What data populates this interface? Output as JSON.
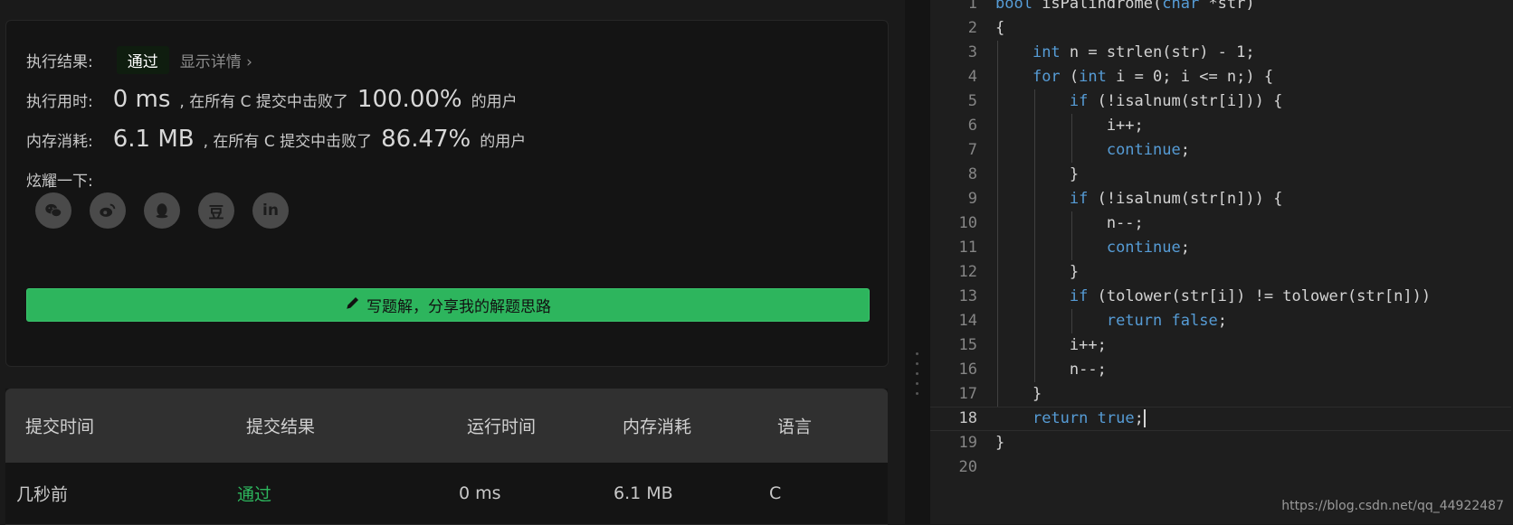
{
  "result": {
    "status_label": "执行结果:",
    "status_value": "通过",
    "show_details": "显示详情",
    "runtime_label": "执行用时:",
    "runtime_value": "0 ms",
    "runtime_mid": ", 在所有 C 提交中击败了",
    "runtime_percent": "100.00%",
    "runtime_suffix": "的用户",
    "memory_label": "内存消耗:",
    "memory_value": "6.1 MB",
    "memory_mid": ", 在所有 C 提交中击败了",
    "memory_percent": "86.47%",
    "memory_suffix": "的用户",
    "share_label": "炫耀一下:",
    "share_icons": [
      "wechat-icon",
      "weibo-icon",
      "qq-icon",
      "douban-icon",
      "linkedin-icon"
    ],
    "douban_glyph": "豆",
    "linkedin_glyph": "in",
    "write_solution": "写题解，分享我的解题思路"
  },
  "submissions": {
    "columns": [
      "提交时间",
      "提交结果",
      "运行时间",
      "内存消耗",
      "语言"
    ],
    "rows": [
      {
        "time": "几秒前",
        "result": "通过",
        "runtime": "0 ms",
        "memory": "6.1 MB",
        "language": "C"
      }
    ]
  },
  "editor": {
    "active_line": 18,
    "lines": [
      [
        [
          "kw",
          "bool"
        ],
        [
          "t",
          " isPalindrome("
        ],
        [
          "kw",
          "char"
        ],
        [
          "t",
          " *str)"
        ]
      ],
      [
        [
          "t",
          "{"
        ]
      ],
      [
        [
          "t",
          "    "
        ],
        [
          "kw",
          "int"
        ],
        [
          "t",
          " n = strlen(str) - 1;"
        ]
      ],
      [
        [
          "t",
          "    "
        ],
        [
          "kw",
          "for"
        ],
        [
          "t",
          " ("
        ],
        [
          "kw",
          "int"
        ],
        [
          "t",
          " i = 0; i <= n;) {"
        ]
      ],
      [
        [
          "t",
          "        "
        ],
        [
          "kw",
          "if"
        ],
        [
          "t",
          " (!isalnum(str[i])) {"
        ]
      ],
      [
        [
          "t",
          "            i++;"
        ]
      ],
      [
        [
          "t",
          "            "
        ],
        [
          "kw",
          "continue"
        ],
        [
          "t",
          ";"
        ]
      ],
      [
        [
          "t",
          "        }"
        ]
      ],
      [
        [
          "t",
          "        "
        ],
        [
          "kw",
          "if"
        ],
        [
          "t",
          " (!isalnum(str[n])) {"
        ]
      ],
      [
        [
          "t",
          "            n--;"
        ]
      ],
      [
        [
          "t",
          "            "
        ],
        [
          "kw",
          "continue"
        ],
        [
          "t",
          ";"
        ]
      ],
      [
        [
          "t",
          "        }"
        ]
      ],
      [
        [
          "t",
          "        "
        ],
        [
          "kw",
          "if"
        ],
        [
          "t",
          " (tolower(str[i]) != tolower(str[n]))"
        ]
      ],
      [
        [
          "t",
          "            "
        ],
        [
          "kw",
          "return"
        ],
        [
          "t",
          " "
        ],
        [
          "kw",
          "false"
        ],
        [
          "t",
          ";"
        ]
      ],
      [
        [
          "t",
          "        i++;"
        ]
      ],
      [
        [
          "t",
          "        n--;"
        ]
      ],
      [
        [
          "t",
          "    }"
        ]
      ],
      [
        [
          "t",
          "    "
        ],
        [
          "kw",
          "return"
        ],
        [
          "t",
          " "
        ],
        [
          "kw",
          "true"
        ],
        [
          "t",
          ";"
        ]
      ],
      [
        [
          "t",
          "}"
        ]
      ],
      []
    ]
  },
  "watermark": "https://blog.csdn.net/qq_44922487",
  "colors": {
    "accent_green": "#2db55d",
    "keyword_blue": "#569cd6"
  }
}
